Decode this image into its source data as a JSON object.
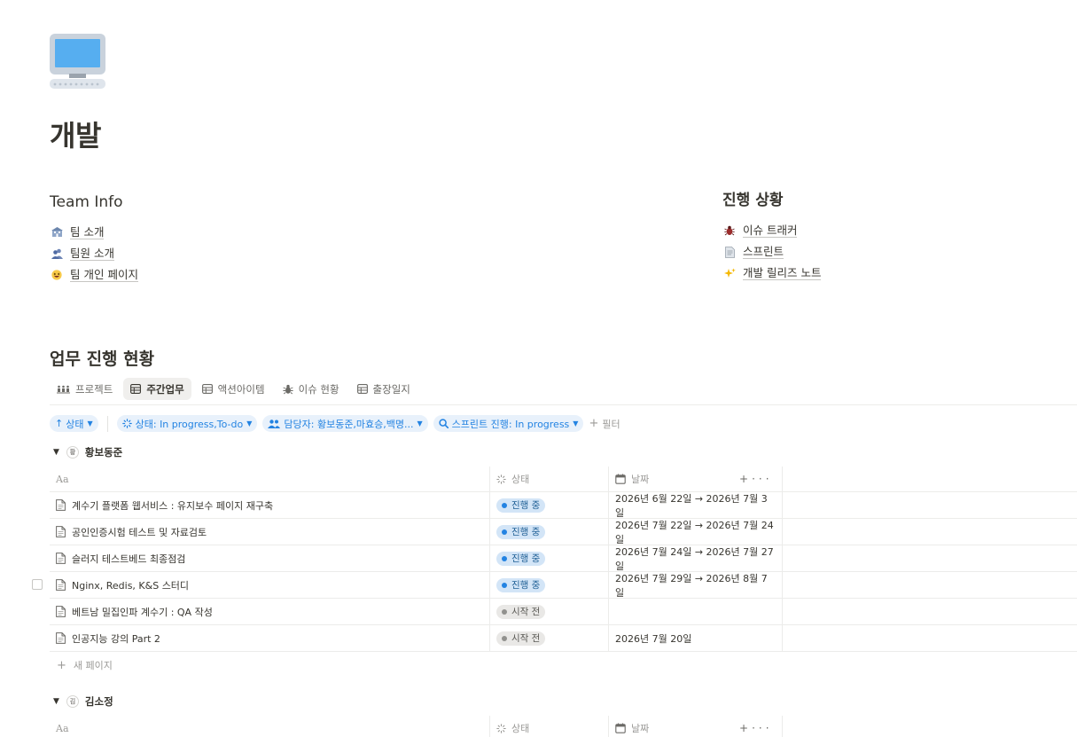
{
  "page": {
    "icon": "computer-icon",
    "title": "개발"
  },
  "team_info": {
    "heading": "Team Info",
    "links": [
      {
        "icon": "office-icon",
        "label": "팀 소개"
      },
      {
        "icon": "people-icon",
        "label": "팀원 소개"
      },
      {
        "icon": "grin-emoji-icon",
        "label": "팀 개인 페이지"
      }
    ]
  },
  "progress": {
    "heading": "진행 상황",
    "links": [
      {
        "icon": "bug-icon",
        "label": "이슈 트래커"
      },
      {
        "icon": "document-icon",
        "label": "스프린트"
      },
      {
        "icon": "sparkles-icon",
        "label": "개발 릴리즈 노트"
      }
    ]
  },
  "database": {
    "title": "업무 진행 현황",
    "tabs": [
      {
        "icon": "people-group-icon",
        "label": "프로젝트",
        "active": false
      },
      {
        "icon": "table-icon",
        "label": "주간업무",
        "active": true
      },
      {
        "icon": "table-icon",
        "label": "액션아이템",
        "active": false
      },
      {
        "icon": "bug-icon",
        "label": "이슈 현황",
        "active": false
      },
      {
        "icon": "table-icon",
        "label": "출장일지",
        "active": false
      }
    ],
    "filters": {
      "sort": "상태",
      "status_filter": "상태: In progress,To-do",
      "assignee_filter": "담당자: 황보동준,마효승,백명...",
      "sprint_filter": "스프린트 진행: In progress",
      "add_filter": "필터"
    },
    "columns": {
      "name": "Aa",
      "status": "상태",
      "date": "날짜",
      "add": "+",
      "more": "···"
    },
    "groups": [
      {
        "avatar": "황",
        "name": "황보동준",
        "rows": [
          {
            "title": "계수기 플랫폼 웹서비스 : 유지보수 페이지 재구축",
            "status": "진행 중",
            "state": "prog",
            "date": "2026년 6월 22일 → 2026년 7월 3일"
          },
          {
            "title": "공인인증시험 테스트 및 자료검토",
            "status": "진행 중",
            "state": "prog",
            "date": "2026년 7월 22일 → 2026년 7월 24일"
          },
          {
            "title": "슬러지 테스트베드 최종점검",
            "status": "진행 중",
            "state": "prog",
            "date": "2026년 7월 24일 → 2026년 7월 27일"
          },
          {
            "title": "Nginx, Redis, K&S 스터디",
            "status": "진행 중",
            "state": "prog",
            "date": "2026년 7월 29일 → 2026년 8월 7일"
          },
          {
            "title": "베트남 밀집인파 계수기 : QA 작성",
            "status": "시작 전",
            "state": "todo",
            "date": ""
          },
          {
            "title": "인공지능 강의 Part 2",
            "status": "시작 전",
            "state": "todo",
            "date": "2026년 7월 20일"
          }
        ],
        "new_page": "새 페이지"
      },
      {
        "avatar": "김",
        "name": "김소정",
        "rows": []
      }
    ]
  }
}
